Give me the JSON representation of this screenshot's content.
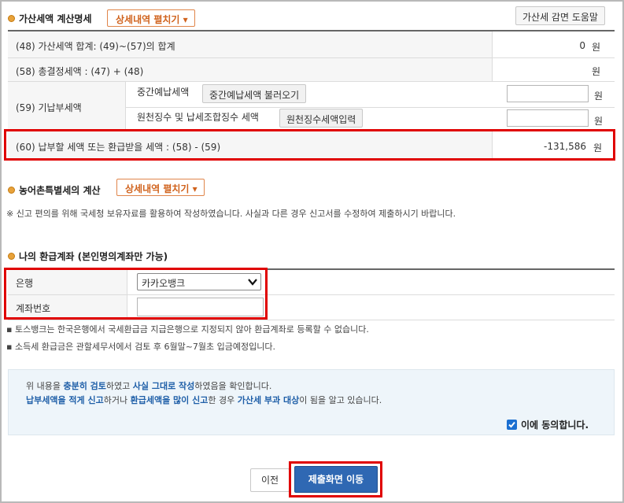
{
  "penalty": {
    "title": "가산세액 계산명세",
    "toggle_label": "상세내역 펼치기 ▾",
    "help_button": "가산세 감면 도움말"
  },
  "rows": {
    "r48": {
      "label": "(48) 가산세액 합계: (49)~(57)의 합계",
      "value": "0",
      "unit": "원"
    },
    "r58": {
      "label": "(58) 총결정세액 : (47) + (48)",
      "value": "",
      "unit": "원"
    },
    "r59": {
      "label": "(59) 기납부세액",
      "sub1_label": "중간예납세액",
      "sub1_button": "중간예납세액 불러오기",
      "sub1_value": "",
      "sub1_unit": "원",
      "sub2_label": "원천징수 및 납세조합징수 세액",
      "sub2_button": "원천징수세액입력",
      "sub2_value": "",
      "sub2_unit": "원"
    },
    "r60": {
      "label": "(60) 납부할 세액 또는 환급받을 세액 : (58) - (59)",
      "value": "-131,586",
      "unit": "원"
    }
  },
  "rural": {
    "title": "농어촌특별세의 계산",
    "toggle_label": "상세내역 펼치기 ▾"
  },
  "notice": "※ 신고 편의를 위해 국세청 보유자료를 활용하여 작성하였습니다. 사실과 다른 경우 신고서를 수정하여 제출하시기 바랍니다.",
  "refund": {
    "title": "나의 환급계좌 (본인명의계좌만 가능)",
    "bank_label": "은행",
    "bank_selected": "카카오뱅크",
    "account_label": "계좌번호",
    "account_value": "",
    "note1": "▪ 토스뱅크는 한국은행에서 국세환급금 지급은행으로 지정되지 않아 환급계좌로 등록할 수 없습니다.",
    "note2": "▪ 소득세 환급금은 관할세무서에서 검토 후 6월말~7월초 입금예정입니다."
  },
  "agreement": {
    "line1_a": "위 내용을 ",
    "line1_b": "충분히 검토",
    "line1_c": "하였고 ",
    "line1_d": "사실 그대로 작성",
    "line1_e": "하였음을 확인합니다.",
    "line2_a": "납부세액을 적게 신고",
    "line2_b": "하거나 ",
    "line2_c": "환급세액을 많이 신고",
    "line2_d": "한 경우 ",
    "line2_e": "가산세 부과 대상",
    "line2_f": "이 됨을 알고 있습니다.",
    "checkbox_label": "이에 동의합니다.",
    "checked": true
  },
  "footer": {
    "prev_button": "이전",
    "submit_button": "제출화면 이동"
  },
  "colors": {
    "highlight": "#e00000",
    "primary_button": "#2f68b3",
    "toggle_accent": "#d0621c"
  }
}
